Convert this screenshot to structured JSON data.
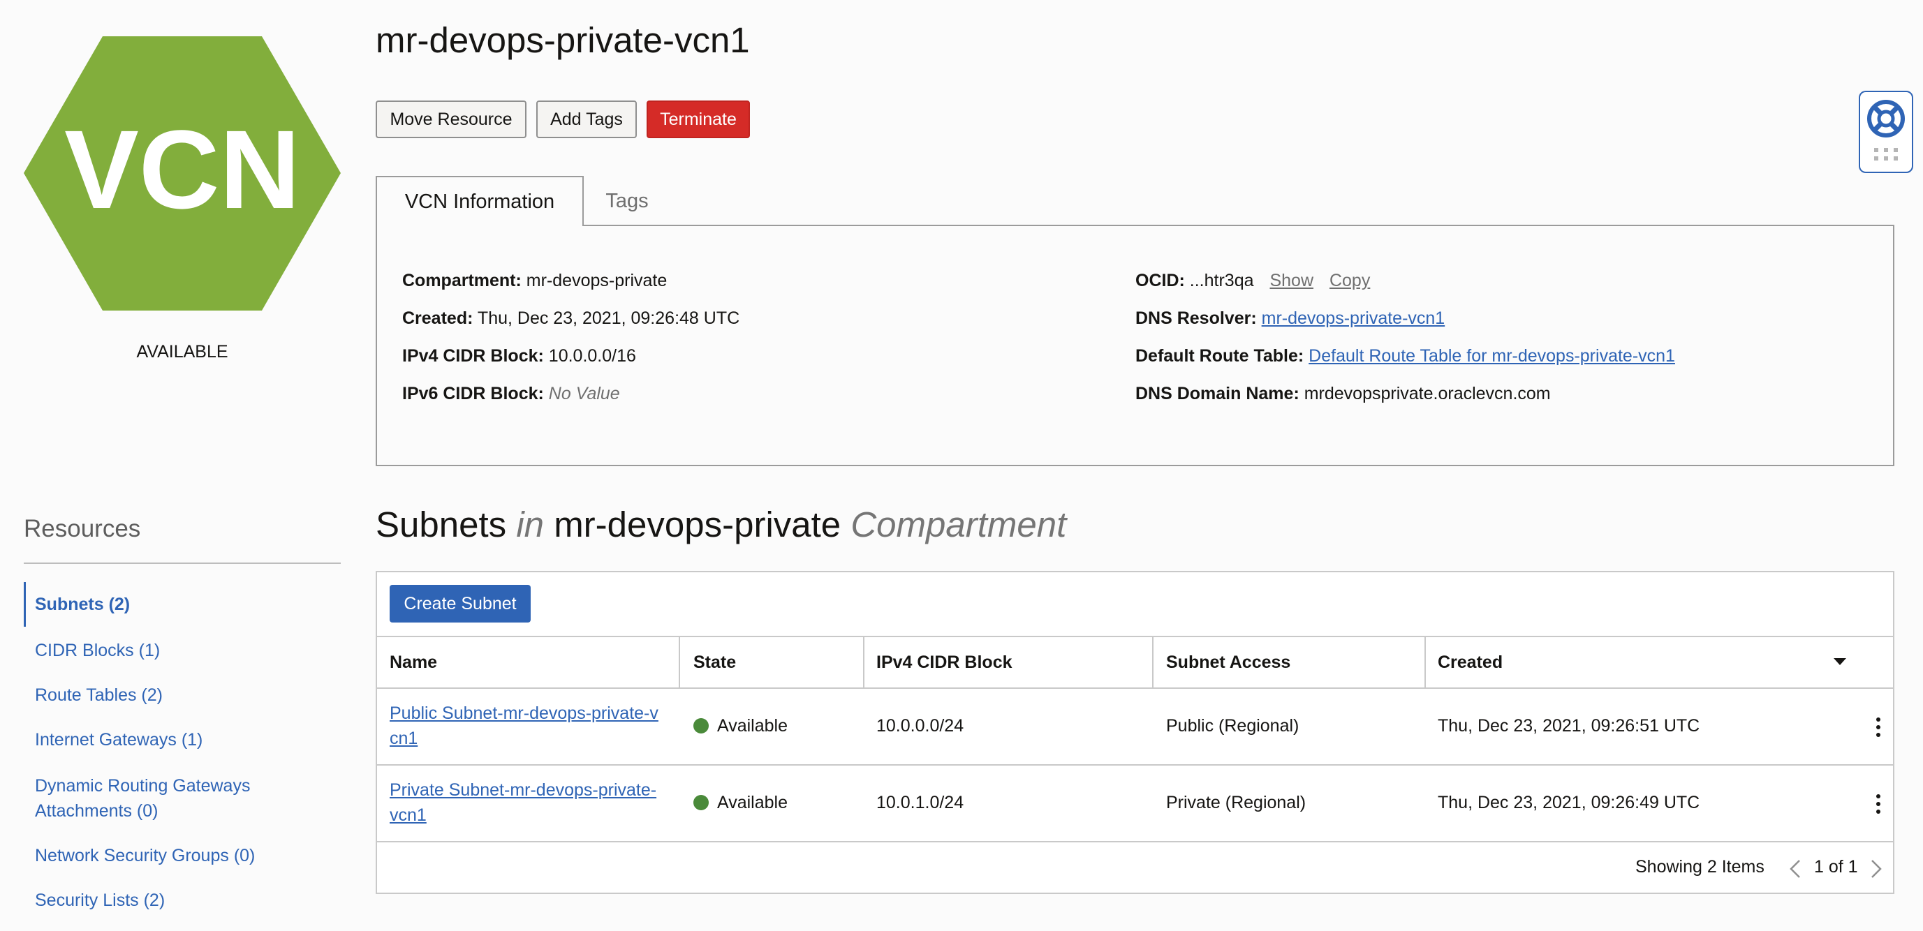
{
  "vcn_badge": {
    "text": "VCN",
    "color": "#82ae3c",
    "status": "AVAILABLE"
  },
  "title": "mr-devops-private-vcn1",
  "actions": {
    "move": "Move Resource",
    "tags": "Add Tags",
    "terminate": "Terminate"
  },
  "tabs": {
    "info": "VCN Information",
    "tags": "Tags"
  },
  "info": {
    "compartment_label": "Compartment:",
    "compartment": "mr-devops-private",
    "created_label": "Created:",
    "created": "Thu, Dec 23, 2021, 09:26:48 UTC",
    "ipv4_label": "IPv4 CIDR Block:",
    "ipv4": "10.0.0.0/16",
    "ipv6_label": "IPv6 CIDR Block:",
    "ipv6": "No Value",
    "ocid_label": "OCID:",
    "ocid": "...htr3qa",
    "ocid_show": "Show",
    "ocid_copy": "Copy",
    "dns_resolver_label": "DNS Resolver:",
    "dns_resolver": "mr-devops-private-vcn1",
    "route_table_label": "Default Route Table:",
    "route_table": "Default Route Table for mr-devops-private-vcn1",
    "dns_domain_label": "DNS Domain Name:",
    "dns_domain": "mrdevopsprivate.oraclevcn.com"
  },
  "resources": {
    "title": "Resources",
    "items": [
      {
        "label": "Subnets (2)"
      },
      {
        "label": "CIDR Blocks (1)"
      },
      {
        "label": "Route Tables (2)"
      },
      {
        "label": "Internet Gateways (1)"
      },
      {
        "label": "Dynamic Routing Gateways Attachments (0)"
      },
      {
        "label": "Network Security Groups (0)"
      },
      {
        "label": "Security Lists (2)"
      }
    ]
  },
  "subnets": {
    "heading_main": "Subnets",
    "heading_in": "in",
    "heading_comp": "mr-devops-private",
    "heading_suffix": "Compartment",
    "create_label": "Create Subnet",
    "columns": {
      "name": "Name",
      "state": "State",
      "cidr": "IPv4 CIDR Block",
      "access": "Subnet Access",
      "created": "Created"
    },
    "rows": [
      {
        "name_line1": "Public Subnet-mr-devops-private-v",
        "name_line2": "cn1",
        "state": "Available",
        "cidr": "10.0.0.0/24",
        "access": "Public (Regional)",
        "created": "Thu, Dec 23, 2021, 09:26:51 UTC"
      },
      {
        "name_line1": "Private Subnet-mr-devops-private-",
        "name_line2": "vcn1",
        "state": "Available",
        "cidr": "10.0.1.0/24",
        "access": "Private (Regional)",
        "created": "Thu, Dec 23, 2021, 09:26:49 UTC"
      }
    ],
    "showing": "Showing 2 Items",
    "page": "1 of 1"
  }
}
